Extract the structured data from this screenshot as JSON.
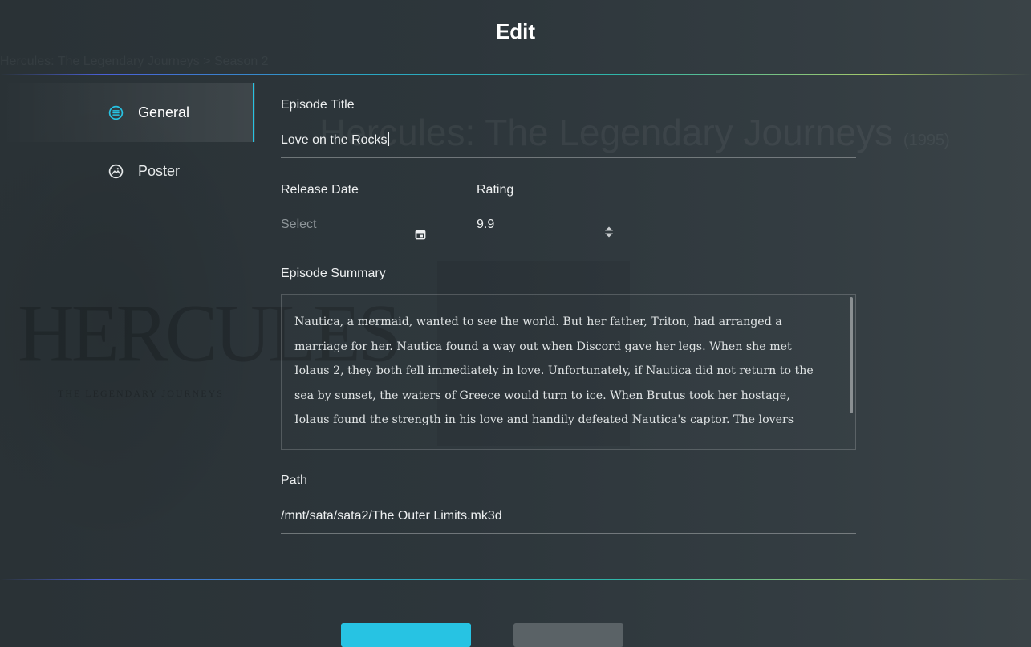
{
  "dialog": {
    "title": "Edit"
  },
  "background": {
    "breadcrumb": "Hercules: The Legendary Journeys > Season 2",
    "show_title": "Hercules: The Legendary Journeys",
    "show_title_suffix": "(1995)",
    "logo_text": "HERCULES",
    "logo_subtext": "THE LEGENDARY JOURNEYS"
  },
  "sidebar": {
    "items": [
      {
        "label": "General",
        "icon": "list-circle-icon",
        "active": true
      },
      {
        "label": "Poster",
        "icon": "image-circle-icon",
        "active": false
      }
    ]
  },
  "form": {
    "episode_title": {
      "label": "Episode Title",
      "value": "Love on the Rocks"
    },
    "release_date": {
      "label": "Release Date",
      "placeholder": "Select",
      "icon": "calendar-icon"
    },
    "rating": {
      "label": "Rating",
      "value": "9.9",
      "icon": "spinner-arrows-icon"
    },
    "summary": {
      "label": "Episode Summary",
      "value": "Nautica, a mermaid, wanted to see the world.  But her father, Triton, had arranged a marriage for her.  Nautica found a way out when Discord gave her legs.  When she met Iolaus 2, they both fell immediately in love.  Unfortunately, if Nautica did not return to the sea by sunset, the waters of Greece would turn to ice.  When Brutus took her hostage, Iolaus found the strength in his love and handily defeated Nautica's captor.  The lovers"
    },
    "path": {
      "label": "Path",
      "value": "/mnt/sata/sata2/The Outer Limits.mk3d"
    }
  },
  "colors": {
    "accent": "#27c3e3",
    "secondary_button": "#5a6266"
  }
}
